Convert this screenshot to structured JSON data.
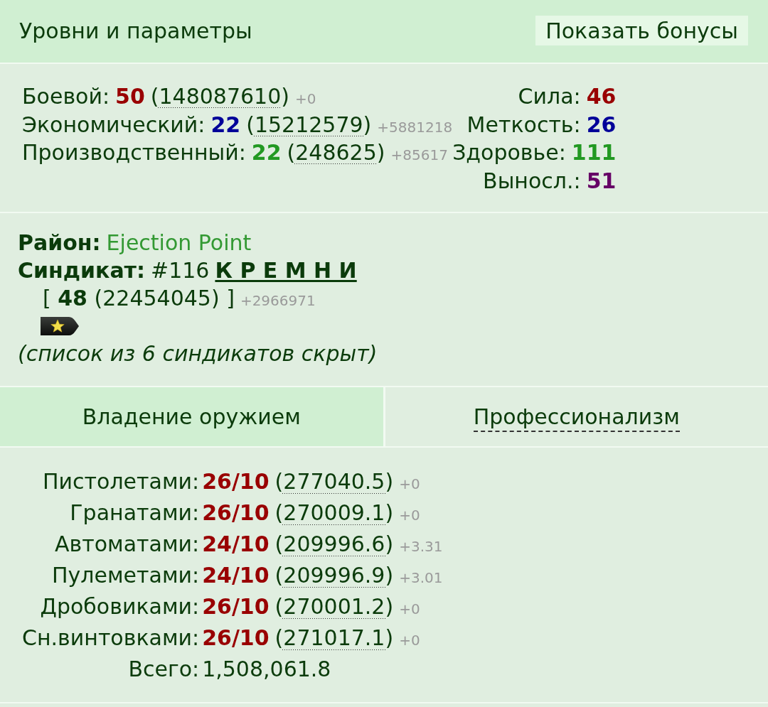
{
  "header": {
    "title": "Уровни и параметры",
    "button": "Показать бонусы"
  },
  "levels": [
    {
      "label": "Боевой:",
      "value": "50",
      "color": "#990000",
      "experience": "(148087610)",
      "delta": "+0"
    },
    {
      "label": "Экономический:",
      "value": "22",
      "color": "#000099",
      "experience": "(15212579)",
      "delta": "+5881218"
    },
    {
      "label": "Производственный:",
      "value": "22",
      "color": "#229922",
      "experience": "(248625)",
      "delta": "+85617"
    }
  ],
  "attributes": [
    {
      "label": "Сила:",
      "value": "46",
      "color": "#990000"
    },
    {
      "label": "Меткость:",
      "value": "26",
      "color": "#000099"
    },
    {
      "label": "Здоровье:",
      "value": "111",
      "color": "#229922"
    },
    {
      "label": "Выносл.:",
      "value": "51",
      "color": "#660066"
    }
  ],
  "district": {
    "label": "Район:",
    "value": "Ejection Point"
  },
  "syndicate": {
    "label": "Синдикат:",
    "number": "#116",
    "name": "К Р Е М Н И",
    "rank": "[ **48** (22454045) ]",
    "delta": "+2966971",
    "note": "(список из 6 синдикатов скрыт)"
  },
  "tabs": [
    {
      "label": "Владение оружием",
      "selected": true
    },
    {
      "label": "Профессионализм",
      "selected": false
    }
  ],
  "weapons": [
    {
      "label": "Пистолетами:",
      "value": "26/10",
      "experience": "(277040.5)",
      "delta": "+0"
    },
    {
      "label": "Гранатами:",
      "value": "26/10",
      "experience": "(270009.1)",
      "delta": "+0"
    },
    {
      "label": "Автоматами:",
      "value": "24/10",
      "experience": "(209996.6)",
      "delta": "+3.31"
    },
    {
      "label": "Пулеметами:",
      "value": "24/10",
      "experience": "(209996.9)",
      "delta": "+3.01"
    },
    {
      "label": "Дробовиками:",
      "value": "26/10",
      "experience": "(270001.2)",
      "delta": "+0"
    },
    {
      "label": "Сн.винтовками:",
      "value": "26/10",
      "experience": "(271017.1)",
      "delta": "+0"
    }
  ],
  "total": {
    "label": "Всего:",
    "value": "1,508,061.8"
  }
}
